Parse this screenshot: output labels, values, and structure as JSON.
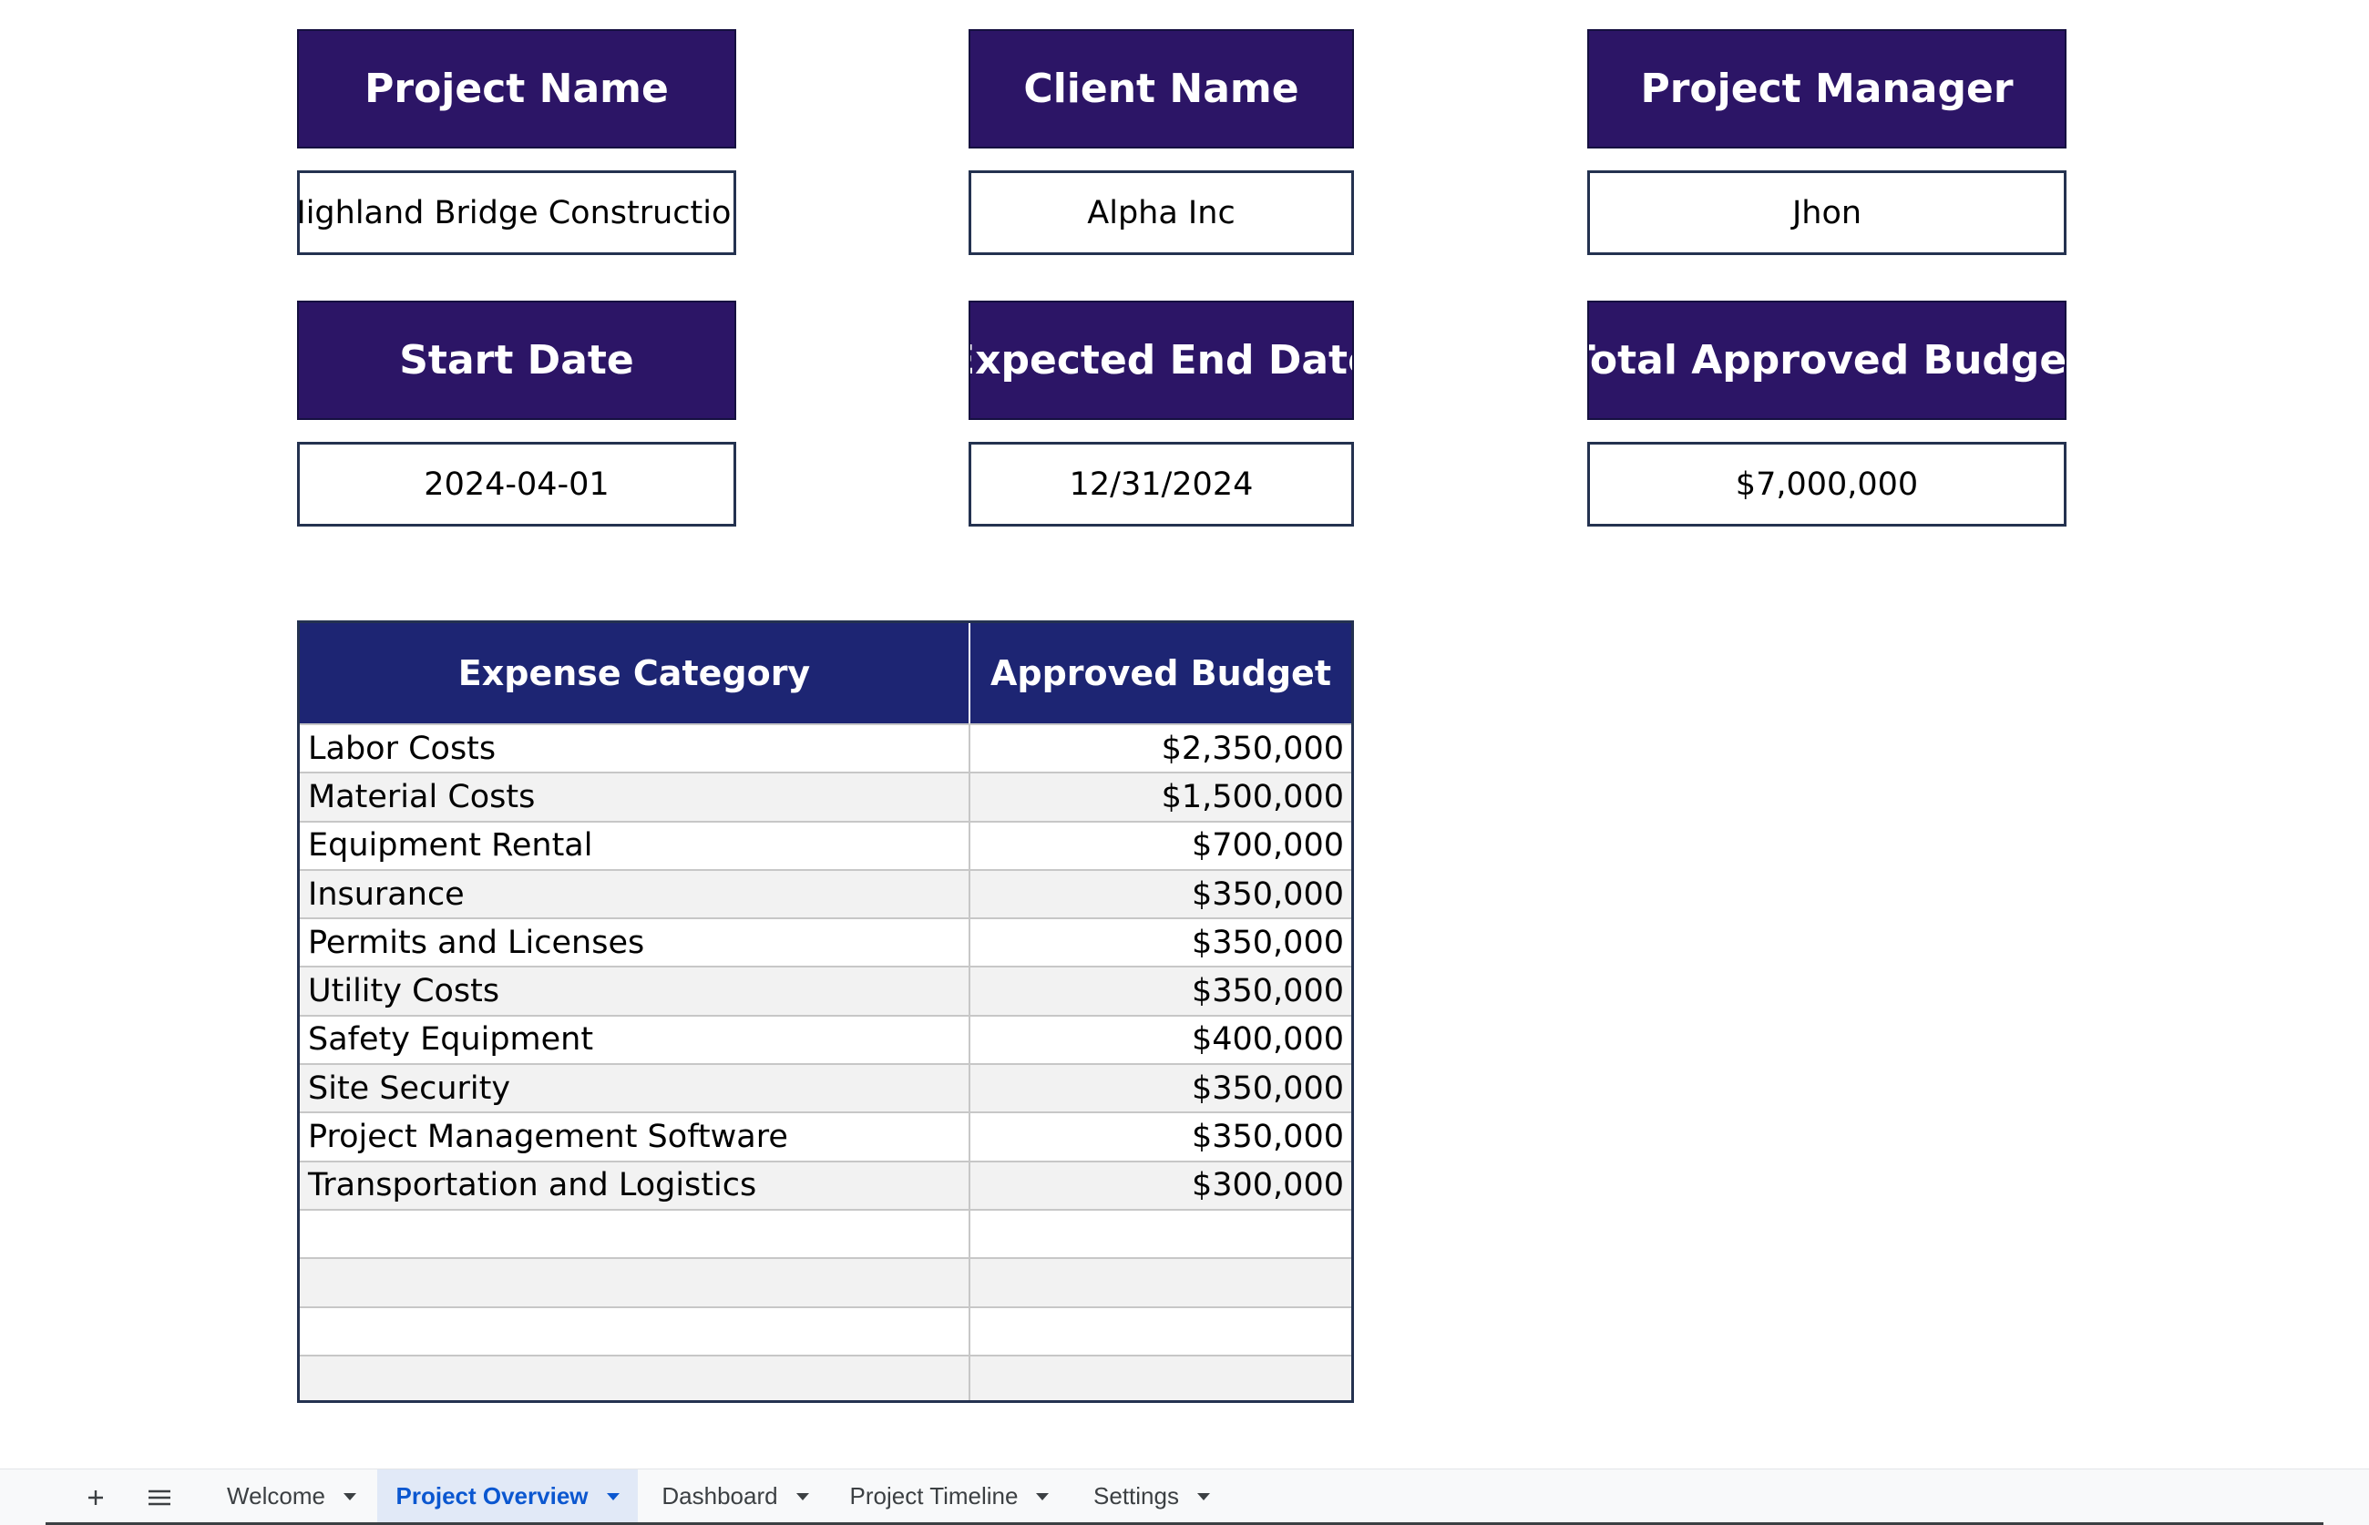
{
  "summary": {
    "project_name": {
      "label": "Project Name",
      "value": "Highland Bridge Construction"
    },
    "client_name": {
      "label": "Client Name",
      "value": "Alpha Inc"
    },
    "project_manager": {
      "label": "Project Manager",
      "value": "Jhon"
    },
    "start_date": {
      "label": "Start Date",
      "value": "2024-04-01"
    },
    "end_date": {
      "label": "Expected End Date",
      "value": "12/31/2024"
    },
    "total_budget": {
      "label": "Total Approved Budget",
      "value": "$7,000,000"
    }
  },
  "expense_table": {
    "headers": [
      "Expense Category",
      "Approved Budget"
    ],
    "rows": [
      {
        "category": "Labor Costs",
        "budget": "$2,350,000"
      },
      {
        "category": "Material Costs",
        "budget": "$1,500,000"
      },
      {
        "category": "Equipment Rental",
        "budget": "$700,000"
      },
      {
        "category": "Insurance",
        "budget": "$350,000"
      },
      {
        "category": "Permits and Licenses",
        "budget": "$350,000"
      },
      {
        "category": "Utility Costs",
        "budget": "$350,000"
      },
      {
        "category": "Safety Equipment",
        "budget": "$400,000"
      },
      {
        "category": "Site Security",
        "budget": "$350,000"
      },
      {
        "category": "Project Management Software",
        "budget": "$350,000"
      },
      {
        "category": "Transportation and Logistics",
        "budget": "$300,000"
      },
      {
        "category": "",
        "budget": ""
      },
      {
        "category": "",
        "budget": ""
      },
      {
        "category": "",
        "budget": ""
      },
      {
        "category": "",
        "budget": ""
      }
    ]
  },
  "tabbar": {
    "add_icon": "plus-icon",
    "menu_icon": "hamburger-icon",
    "tabs": [
      {
        "label": "Welcome",
        "active": false
      },
      {
        "label": "Project Overview",
        "active": true
      },
      {
        "label": "Dashboard",
        "active": false
      },
      {
        "label": "Project Timeline",
        "active": false
      },
      {
        "label": "Settings",
        "active": false
      }
    ]
  },
  "colors": {
    "header_purple": "#2c1566",
    "table_header_navy": "#1d2573",
    "active_tab_bg": "#e1e9f7",
    "active_tab_text": "#0b57d0"
  }
}
